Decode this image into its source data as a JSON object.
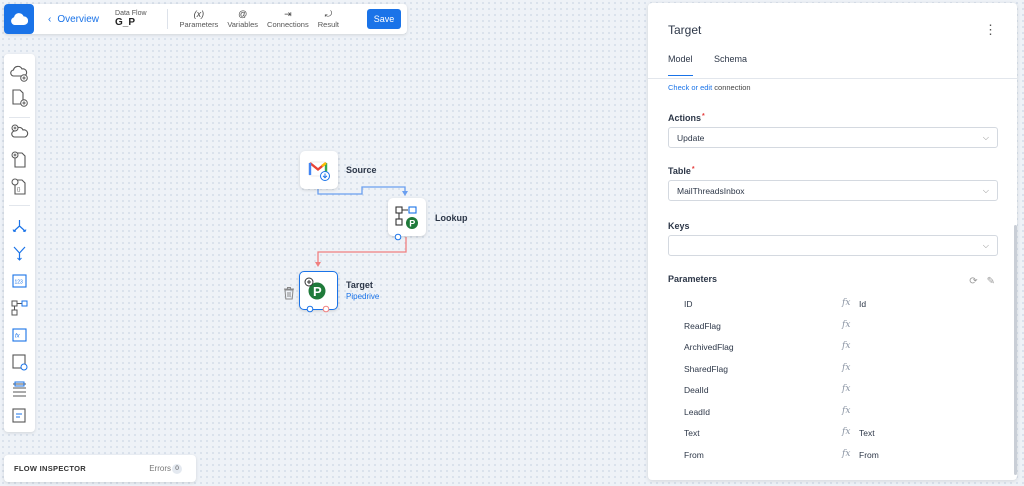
{
  "topbar": {
    "overview_label": "Overview",
    "flow_label": "Data Flow",
    "flow_name": "G_P",
    "tools": [
      {
        "icon": "(x)",
        "label": "Parameters"
      },
      {
        "icon": "@",
        "label": "Variables"
      },
      {
        "icon": "⇥",
        "label": "Connections"
      },
      {
        "icon": "⤾",
        "label": "Result"
      }
    ],
    "save_label": "Save"
  },
  "nodes": {
    "source": {
      "title": "Source"
    },
    "lookup": {
      "title": "Lookup"
    },
    "target": {
      "title": "Target",
      "subtitle": "Pipedrive"
    }
  },
  "inspector": {
    "title": "FLOW INSPECTOR",
    "errors_label": "Errors",
    "errors_count": "0"
  },
  "panel": {
    "title": "Target",
    "tabs": [
      "Model",
      "Schema"
    ],
    "connection_link": "Check or edit",
    "connection_text": "connection",
    "actions_label": "Actions",
    "actions_value": "Update",
    "table_label": "Table",
    "table_value": "MailThreadsInbox",
    "keys_label": "Keys",
    "keys_value": "",
    "parameters_label": "Parameters",
    "fx_glyph": "fx",
    "params": [
      {
        "name": "ID",
        "value": "Id"
      },
      {
        "name": "ReadFlag",
        "value": ""
      },
      {
        "name": "ArchivedFlag",
        "value": ""
      },
      {
        "name": "SharedFlag",
        "value": ""
      },
      {
        "name": "DealId",
        "value": ""
      },
      {
        "name": "LeadId",
        "value": ""
      },
      {
        "name": "Text",
        "value": "Text"
      },
      {
        "name": "From",
        "value": "From"
      }
    ]
  },
  "colors": {
    "accent": "#1a73e8",
    "link_blue": "#6a9ff0",
    "link_red": "#f08080",
    "pipedrive_green": "#1f7a3a"
  }
}
